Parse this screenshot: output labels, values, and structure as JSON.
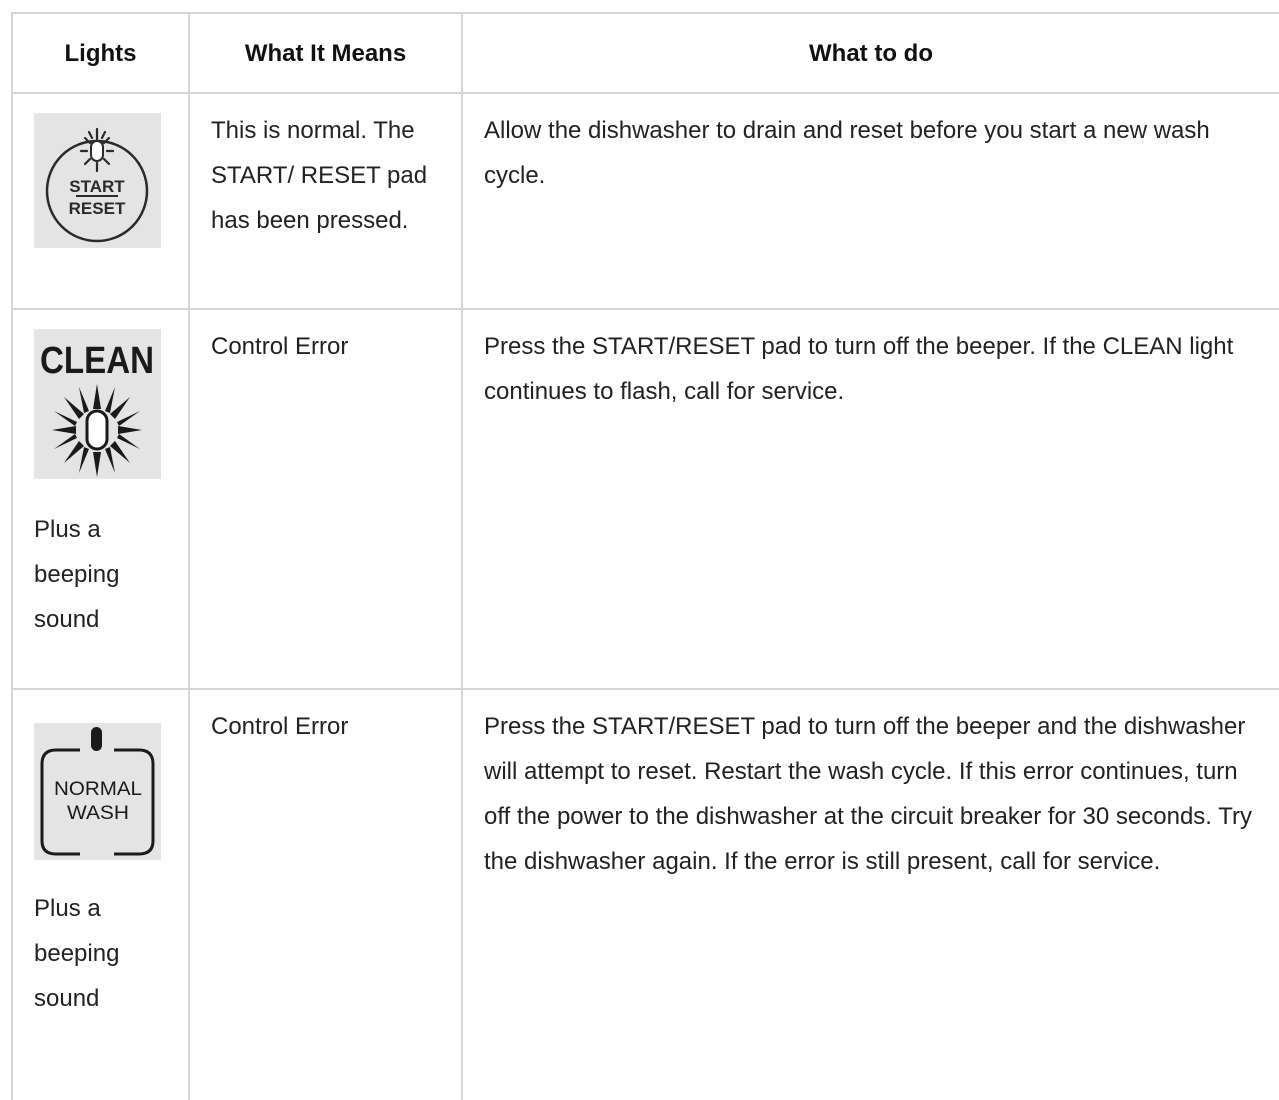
{
  "table": {
    "headers": {
      "lights": "Lights",
      "meaning": "What It Means",
      "todo": "What to do"
    },
    "rows": [
      {
        "icon": "start-reset-light-icon",
        "icon_text": [
          "START",
          "RESET"
        ],
        "light_note": "",
        "meaning": "This is normal. The START/ RESET pad has been pressed.",
        "todo": "Allow the dishwasher to drain and reset before you start a new wash cycle."
      },
      {
        "icon": "clean-light-icon",
        "icon_text": [
          "CLEAN"
        ],
        "light_note": "Plus a beeping sound",
        "meaning": "Control Error",
        "todo": "Press the START/RESET pad to turn off the beeper. If the CLEAN light continues to flash, call for service."
      },
      {
        "icon": "normal-wash-light-icon",
        "icon_text": [
          "NORMAL",
          "WASH"
        ],
        "light_note": "Plus a beeping sound",
        "meaning": "Control Error",
        "todo": "Press the START/RESET pad to turn off the beeper and the dishwasher will attempt to reset. Restart the wash cycle. If this error continues, turn off the power to the dishwasher at the circuit breaker for 30 seconds. Try the dishwasher again. If the error is still present, call for service."
      }
    ]
  }
}
